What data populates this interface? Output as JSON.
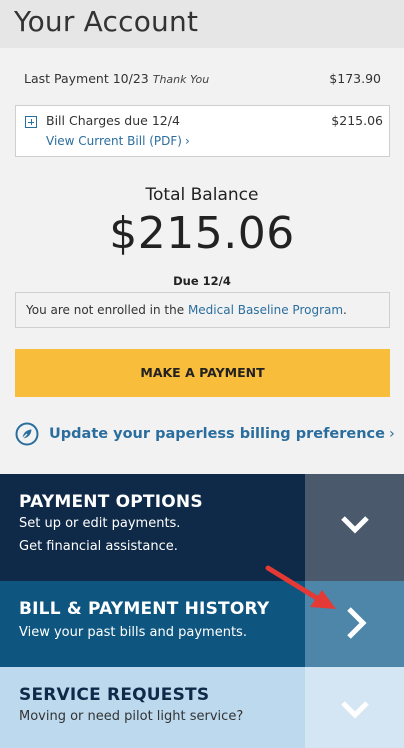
{
  "header": {
    "title": "Your Account"
  },
  "account": {
    "last_payment_label": "Last Payment 10/23",
    "last_payment_note": "Thank You",
    "last_payment_amount": "$173.90",
    "bill_charges_label": "Bill Charges due 12/4",
    "bill_charges_amount": "$215.06",
    "view_bill_link": "View Current Bill (PDF)",
    "total_balance_label": "Total Balance",
    "total_balance_amount": "$215.06",
    "due_label": "Due 12/4",
    "notice_prefix": "You are not enrolled in the ",
    "notice_link": "Medical Baseline Program",
    "notice_suffix": ".",
    "make_payment_label": "MAKE A PAYMENT",
    "paperless_link": "Update your paperless billing preference"
  },
  "sections": [
    {
      "title": "PAYMENT OPTIONS",
      "lines": [
        "Set up or edit payments.",
        "Get financial assistance."
      ],
      "chevron": "chevron-down-icon"
    },
    {
      "title": "BILL & PAYMENT HISTORY",
      "lines": [
        "View your past bills and payments."
      ],
      "chevron": "chevron-right-icon"
    },
    {
      "title": "SERVICE REQUESTS",
      "lines": [
        "Moving or need pilot light service?"
      ],
      "chevron": "chevron-down-icon"
    }
  ],
  "glyphs": {
    "chevron_small": "›"
  },
  "colors": {
    "accent_yellow": "#f8bd3a",
    "link_blue": "#2b6e9e",
    "navy": "#0e2a48",
    "mid_blue": "#0e5680",
    "light_blue": "#bcd9ee",
    "annotation_red": "#e53935"
  }
}
